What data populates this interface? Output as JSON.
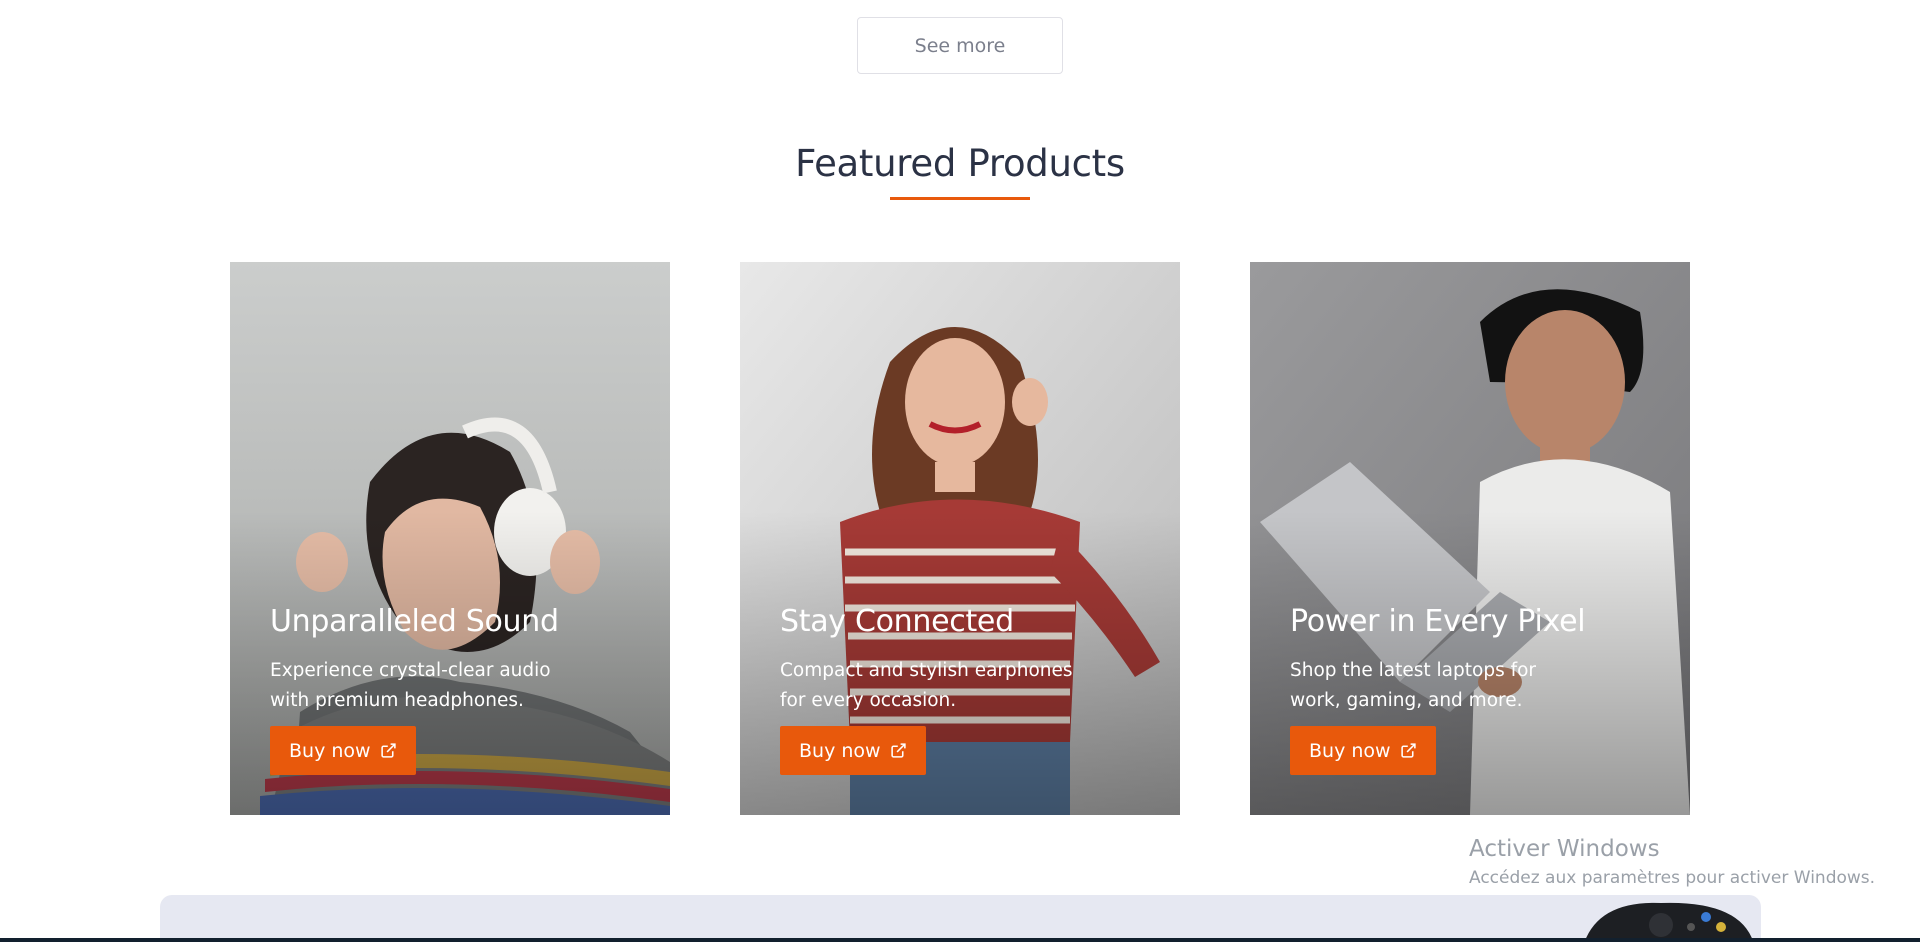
{
  "see_more": {
    "label": "See more"
  },
  "featured": {
    "title": "Featured Products",
    "accent_color": "#e8590c",
    "cards": [
      {
        "title": "Unparalleled Sound",
        "description": "Experience crystal-clear audio with premium headphones.",
        "button_label": "Buy now",
        "button_icon": "external-link-icon",
        "image": "woman-with-headphones"
      },
      {
        "title": "Stay Connected",
        "description": "Compact and stylish earphones for every occasion.",
        "button_label": "Buy now",
        "button_icon": "external-link-icon",
        "image": "woman-with-earphones"
      },
      {
        "title": "Power in Every Pixel",
        "description": "Shop the latest laptops for work, gaming, and more.",
        "button_label": "Buy now",
        "button_icon": "external-link-icon",
        "image": "man-with-laptop"
      }
    ]
  },
  "watermark": {
    "title": "Activer Windows",
    "subtitle": "Accédez aux paramètres pour activer Windows."
  }
}
